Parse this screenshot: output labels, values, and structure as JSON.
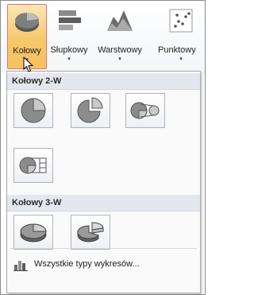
{
  "ribbon": {
    "buttons": [
      {
        "label": "Kołowy",
        "active": true
      },
      {
        "label": "Słupkowy",
        "active": false
      },
      {
        "label": "Warstwowy",
        "active": false
      },
      {
        "label": "Punktowy",
        "active": false
      }
    ],
    "dropdown_arrow": "▾"
  },
  "menu": {
    "section_2d": {
      "title": "Kołowy 2-W",
      "items": [
        "pie-2d-icon",
        "exploded-pie-2d-icon",
        "pie-of-pie-2d-icon",
        "bar-of-pie-2d-icon"
      ]
    },
    "section_3d": {
      "title": "Kołowy 3-W",
      "items": [
        "pie-3d-icon",
        "exploded-pie-3d-icon"
      ]
    },
    "all_charts_label": "Wszystkie typy wykresów..."
  },
  "colors": {
    "accent_active": "#f7c86a",
    "active_border": "#e0766f",
    "section_bg": "#e4e8ee",
    "icon_gray": "#7d7d7d"
  }
}
